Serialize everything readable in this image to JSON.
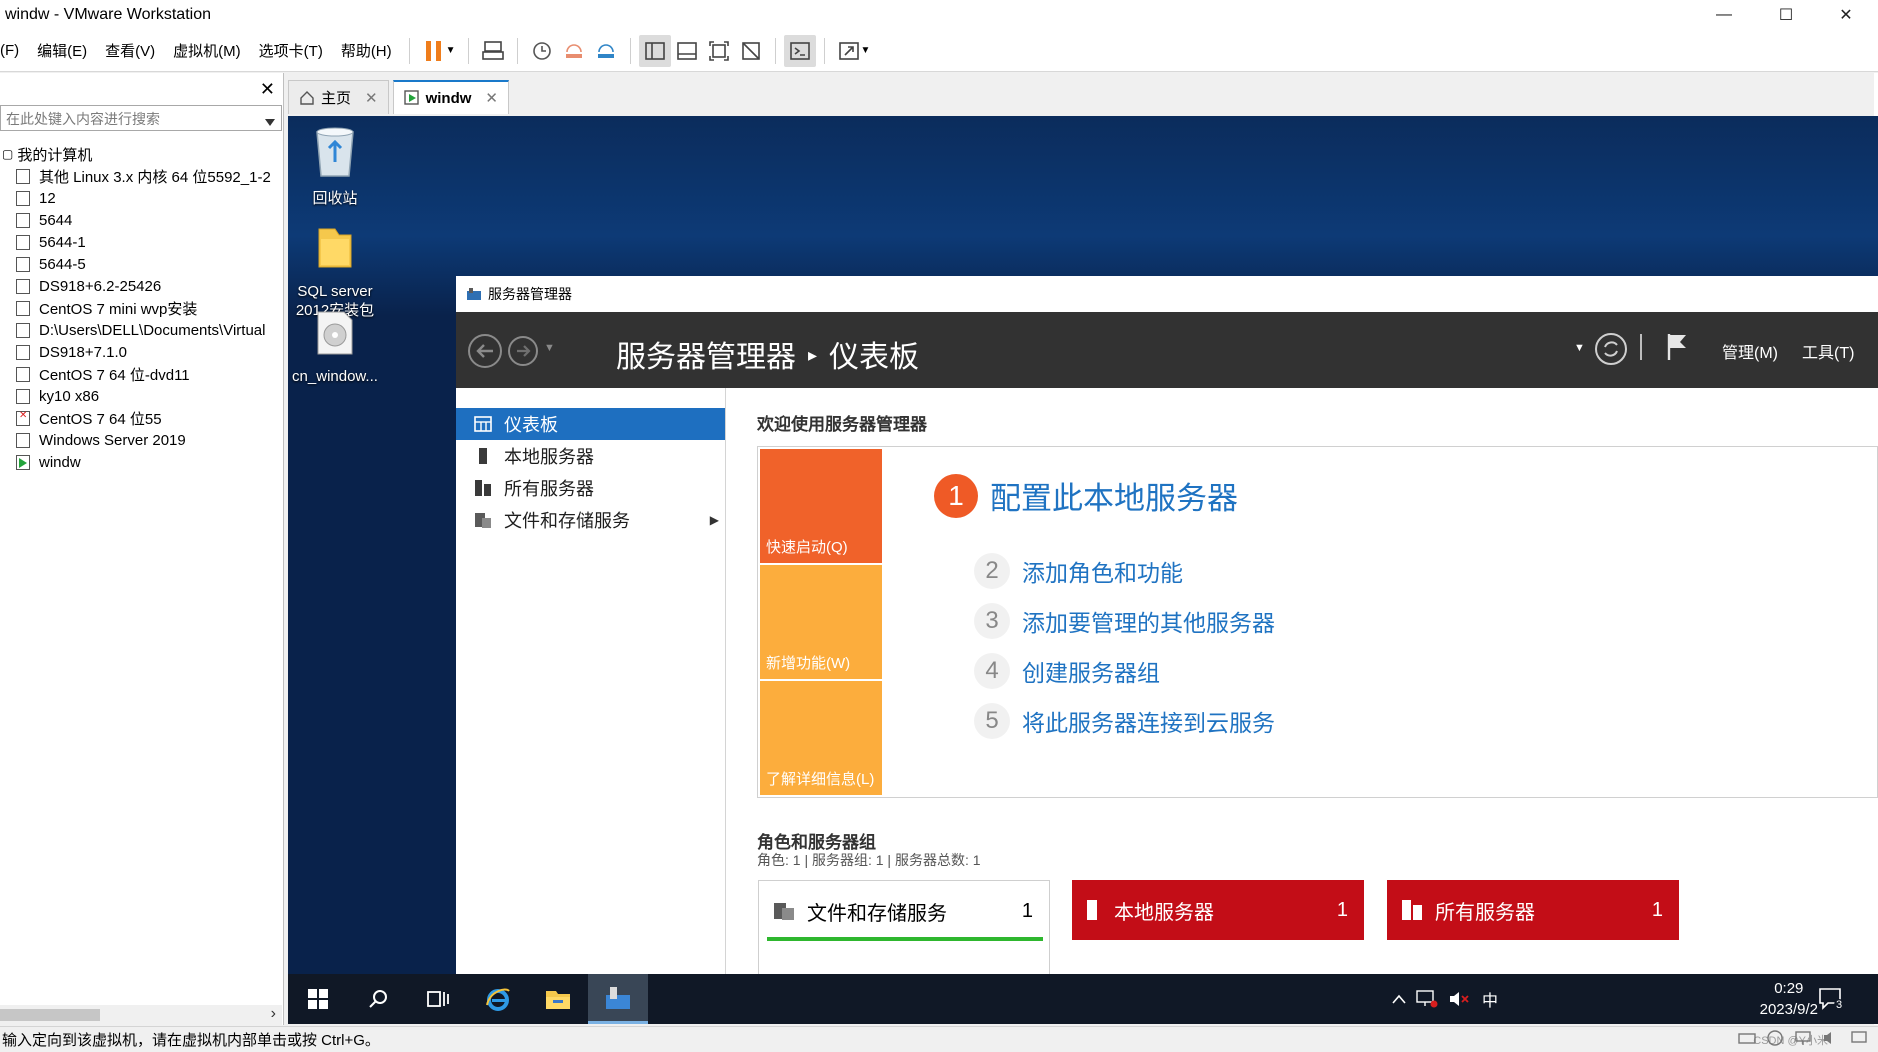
{
  "window": {
    "title": "windw - VMware Workstation",
    "minimize": "—",
    "maximize": "☐",
    "close": "✕"
  },
  "menu": {
    "items": [
      "(F)",
      "编辑(E)",
      "查看(V)",
      "虚拟机(M)",
      "选项卡(T)",
      "帮助(H)"
    ]
  },
  "library": {
    "close": "✕",
    "search_placeholder": "在此处键入内容进行搜索",
    "root": "我的计算机",
    "vms": [
      {
        "name": "其他 Linux 3.x 内核 64 位5592_1-2",
        "state": "off"
      },
      {
        "name": "12",
        "state": "off"
      },
      {
        "name": "5644",
        "state": "off"
      },
      {
        "name": "5644-1",
        "state": "off"
      },
      {
        "name": "5644-5",
        "state": "off"
      },
      {
        "name": "DS918+6.2-25426",
        "state": "off"
      },
      {
        "name": "CentOS 7 mini  wvp安装",
        "state": "off"
      },
      {
        "name": "D:\\Users\\DELL\\Documents\\Virtual",
        "state": "off"
      },
      {
        "name": "DS918+7.1.0",
        "state": "off"
      },
      {
        "name": "CentOS 7 64 位-dvd11",
        "state": "off"
      },
      {
        "name": "ky10 x86",
        "state": "off"
      },
      {
        "name": "CentOS 7 64 位55",
        "state": "error"
      },
      {
        "name": "Windows Server 2019",
        "state": "off"
      },
      {
        "name": "windw",
        "state": "running"
      }
    ]
  },
  "tabs": [
    {
      "label": "主页",
      "close": "✕"
    },
    {
      "label": "windw",
      "close": "✕"
    }
  ],
  "desktop": {
    "icons": [
      "回收站",
      "SQL server\n2012安装包",
      "cn_window..."
    ]
  },
  "server_manager": {
    "window_title": "服务器管理器",
    "breadcrumb_app": "服务器管理器",
    "breadcrumb_sep": "▸",
    "breadcrumb_page": "仪表板",
    "manage_menu": "管理(M)",
    "tools_menu": "工具(T)",
    "nav": [
      {
        "label": "仪表板",
        "active": true
      },
      {
        "label": "本地服务器",
        "active": false
      },
      {
        "label": "所有服务器",
        "active": false
      },
      {
        "label": "文件和存储服务",
        "active": false
      }
    ],
    "welcome": "欢迎使用服务器管理器",
    "tiles": [
      {
        "label": "快速启动(Q)",
        "color": "#f0622a"
      },
      {
        "label": "新增功能(W)",
        "color": "#fcad3d"
      },
      {
        "label": "了解详细信息(L)",
        "color": "#fcad3d"
      }
    ],
    "steps": [
      {
        "num": "1",
        "label": "配置此本地服务器"
      },
      {
        "num": "2",
        "label": "添加角色和功能"
      },
      {
        "num": "3",
        "label": "添加要管理的其他服务器"
      },
      {
        "num": "4",
        "label": "创建服务器组"
      },
      {
        "num": "5",
        "label": "将此服务器连接到云服务"
      }
    ],
    "roles_title": "角色和服务器组",
    "roles_sub": "角色: 1 | 服务器组: 1 | 服务器总数: 1",
    "role_cards": [
      {
        "label": "文件和存储服务",
        "count": "1"
      },
      {
        "label": "本地服务器",
        "count": "1"
      },
      {
        "label": "所有服务器",
        "count": "1"
      }
    ]
  },
  "taskbar": {
    "ime": "中",
    "time": "0:29",
    "date": "2023/9/2",
    "notif_count": "3"
  },
  "statusbar": {
    "text": "输入定向到该虚拟机，请在虚拟机内部单击或按 Ctrl+G。",
    "watermark": "CSDN @Y小米"
  },
  "colors": {
    "sm_header": "#323232",
    "sm_accent": "#1e6fc0",
    "role_red": "#c30d17",
    "step_orange": "#ef5a26"
  }
}
